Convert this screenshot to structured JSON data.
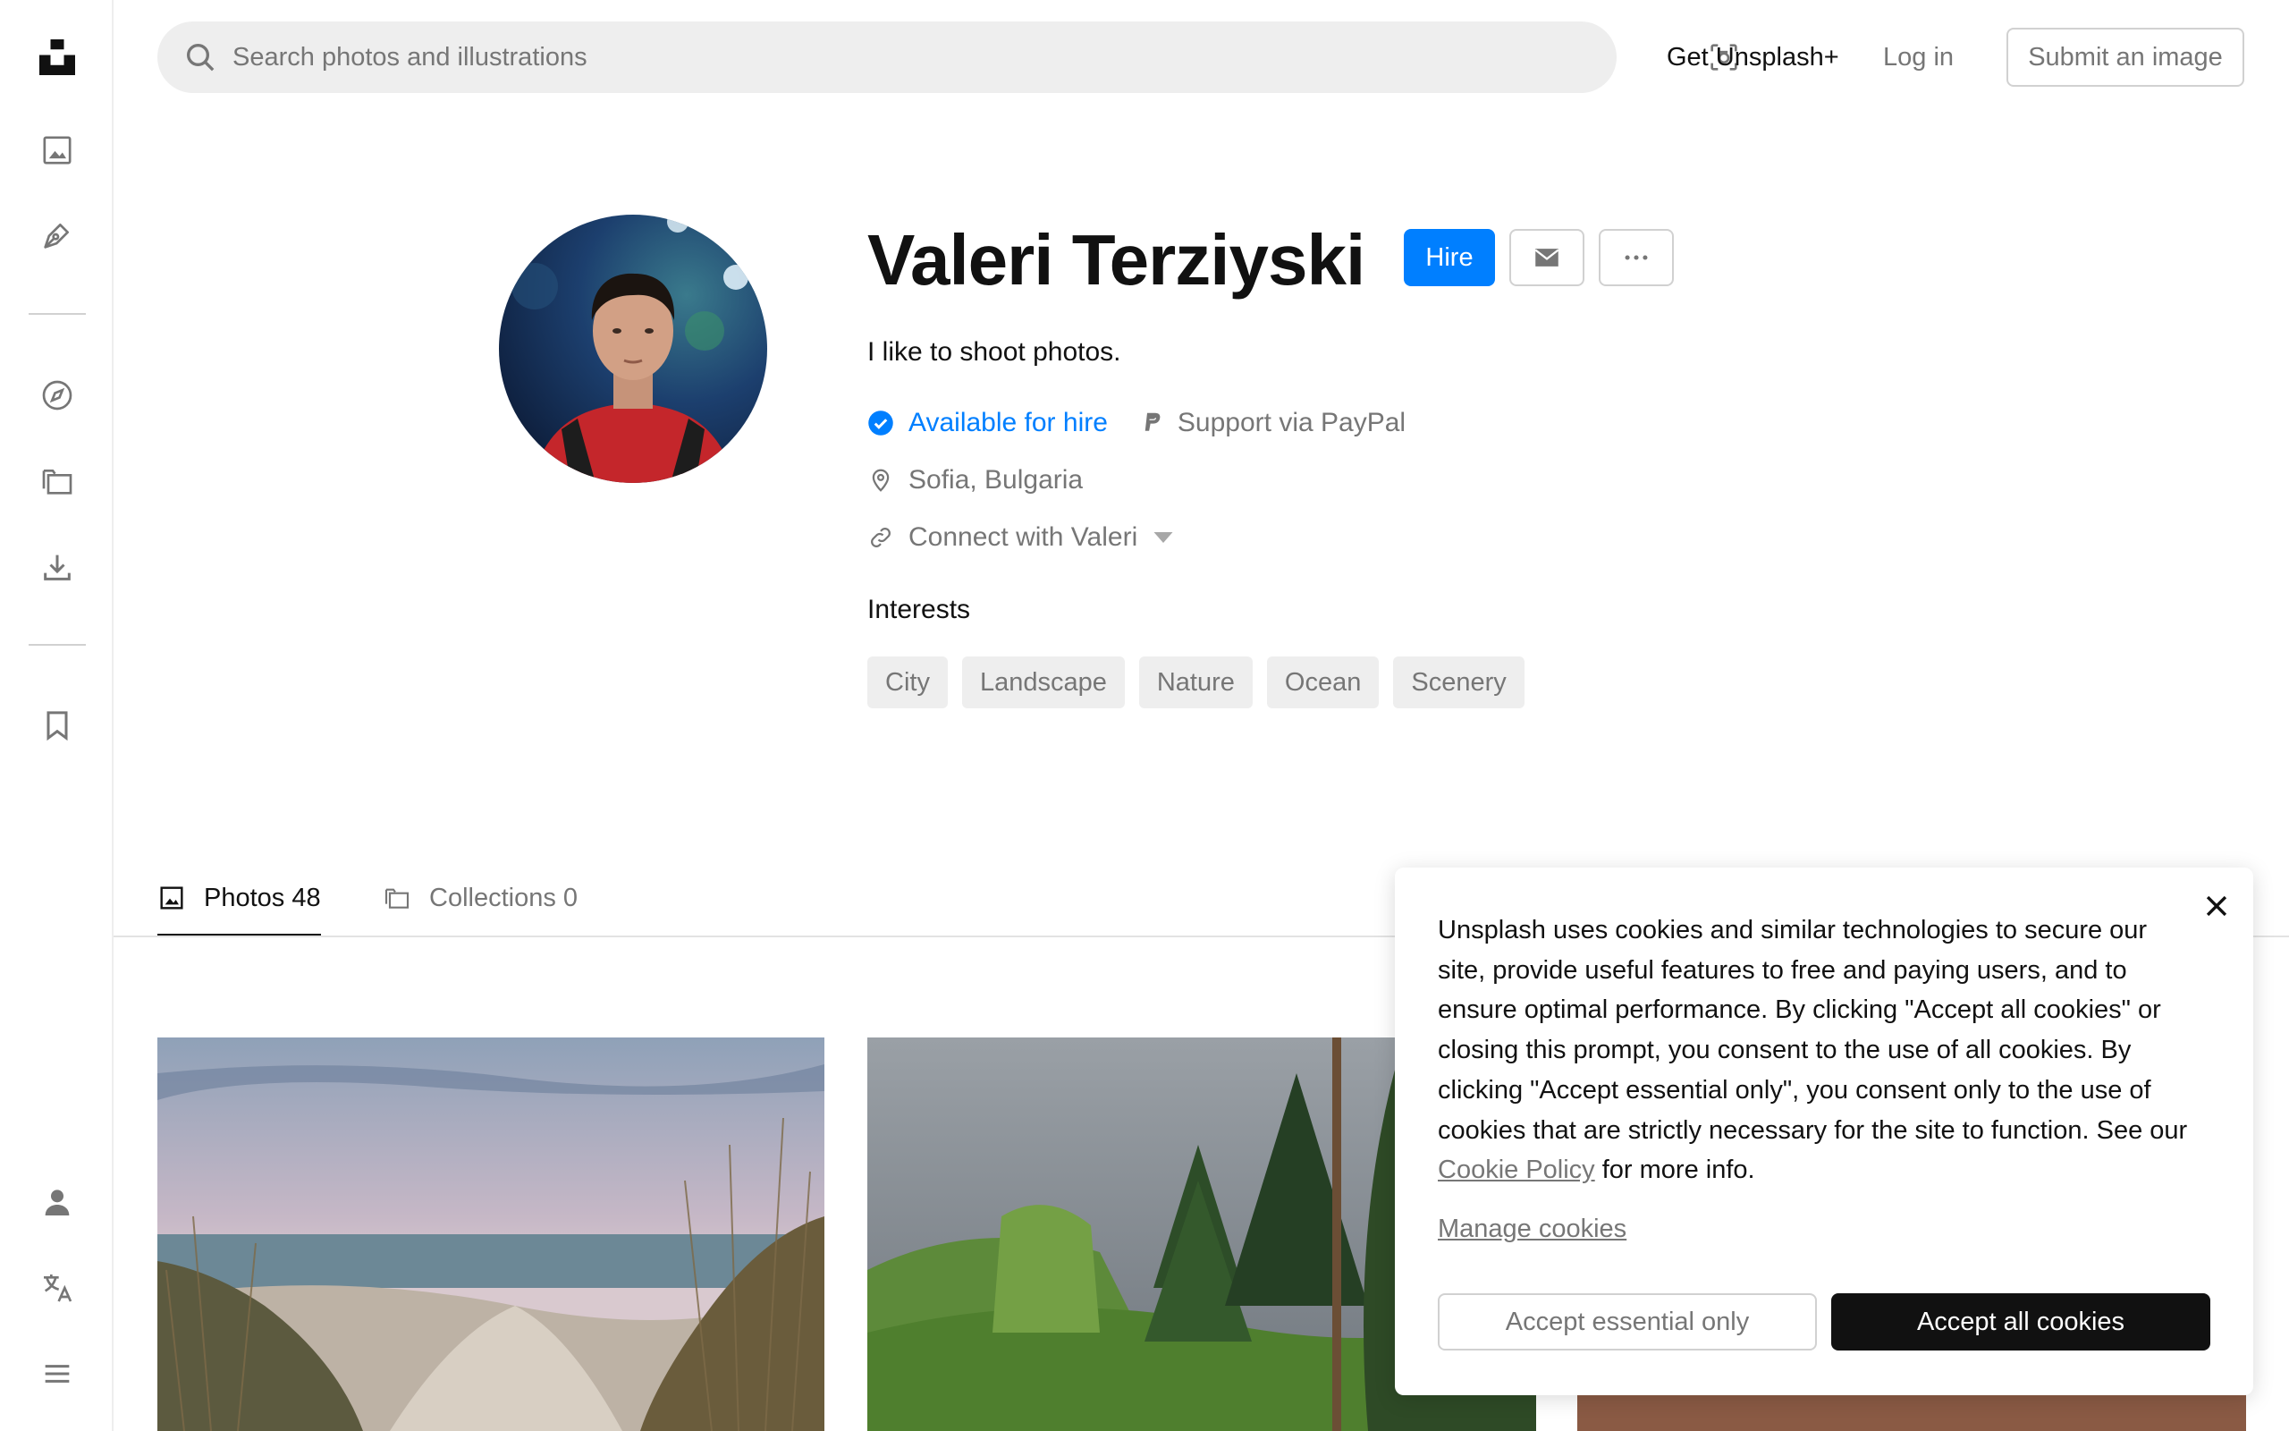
{
  "sidebar": {
    "items": [
      {
        "icon": "unsplash-logo-icon"
      },
      {
        "icon": "photos-icon"
      },
      {
        "icon": "illustrations-pen-icon"
      },
      {
        "icon": "explore-compass-icon"
      },
      {
        "icon": "collections-icon"
      },
      {
        "icon": "download-icon"
      },
      {
        "icon": "bookmark-icon"
      },
      {
        "icon": "user-icon"
      },
      {
        "icon": "language-icon"
      },
      {
        "icon": "menu-icon"
      }
    ]
  },
  "header": {
    "search_placeholder": "Search photos and illustrations",
    "get_plus": "Get Unsplash+",
    "login": "Log in",
    "submit": "Submit an image"
  },
  "profile": {
    "name": "Valeri Terziyski",
    "hire_label": "Hire",
    "bio": "I like to shoot photos.",
    "available": "Available for hire",
    "paypal": "Support via PayPal",
    "location": "Sofia, Bulgaria",
    "connect": "Connect with Valeri",
    "interests_title": "Interests",
    "interests": [
      "City",
      "Landscape",
      "Nature",
      "Ocean",
      "Scenery"
    ]
  },
  "tabs": {
    "photos_label": "Photos",
    "photos_count": "48",
    "collections_label": "Collections",
    "collections_count": "0"
  },
  "cookie": {
    "text_before": "Unsplash uses cookies and similar technologies to secure our site, provide useful features to free and paying users, and to ensure optimal performance. By clicking \"Accept all cookies\" or closing this prompt, you consent to the use of all cookies. By clicking \"Accept essential only\", you consent only to the use of cookies that are strictly necessary for the site to function. See our ",
    "policy_link": "Cookie Policy",
    "text_after": " for more info.",
    "manage": "Manage cookies",
    "accept_essential": "Accept essential only",
    "accept_all": "Accept all cookies"
  },
  "colors": {
    "accent": "#007fff",
    "text": "#111111",
    "muted": "#767676",
    "chip_bg": "#eeeeee",
    "border": "#d1d1d1"
  }
}
